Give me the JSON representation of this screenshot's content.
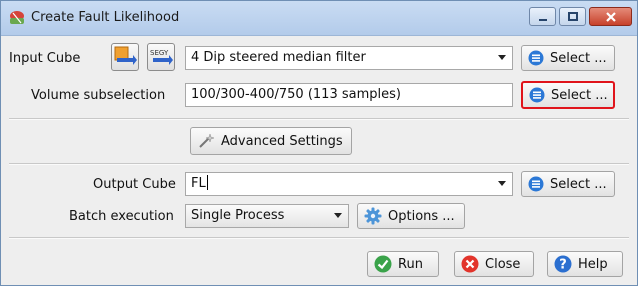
{
  "window": {
    "title": "Create Fault Likelihood"
  },
  "input_cube": {
    "label": "Input Cube",
    "value": "4 Dip steered median filter",
    "select_label": "Select ..."
  },
  "volume_subselection": {
    "label": "Volume subselection",
    "value": "100/300-400/750 (113 samples)",
    "select_label": "Select ..."
  },
  "advanced_settings": {
    "label": "Advanced Settings"
  },
  "output_cube": {
    "label": "Output Cube",
    "value": "FL",
    "select_label": "Select ..."
  },
  "batch_execution": {
    "label": "Batch execution",
    "value": "Single Process",
    "options_label": "Options ..."
  },
  "footer": {
    "run_label": "Run",
    "close_label": "Close",
    "help_label": "Help"
  },
  "icons": {
    "app": "fault-app-icon",
    "input_from_stored": "orange-cube-arrow-icon",
    "input_from_segy": "segy-arrow-icon",
    "select": "blue-list-icon",
    "advanced": "wand-icon",
    "options": "gear-icon",
    "run": "green-check-icon",
    "close": "red-x-icon",
    "help": "blue-question-icon"
  },
  "colors": {
    "highlight_border": "#e0141b",
    "title_bar": "#b3cbea"
  }
}
